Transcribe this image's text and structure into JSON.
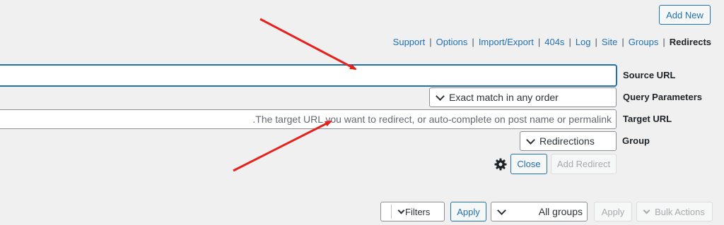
{
  "header": {
    "add_new_label": "Add New"
  },
  "subnav": {
    "items": [
      {
        "label": "Support"
      },
      {
        "label": "Options"
      },
      {
        "label": "Import/Export"
      },
      {
        "label": "404s"
      },
      {
        "label": "Log"
      },
      {
        "label": "Site"
      },
      {
        "label": "Groups"
      }
    ],
    "current": "Redirects",
    "separator": "|"
  },
  "form": {
    "source_url": {
      "label": "Source URL",
      "value": ""
    },
    "query_parameters": {
      "label": "Query Parameters",
      "selected": "Exact match in any order"
    },
    "target_url": {
      "label": "Target URL",
      "placeholder": ".The target URL you want to redirect, or auto-complete on post name or permalink"
    },
    "group": {
      "label": "Group",
      "selected": "Redirections"
    },
    "close_label": "Close",
    "add_redirect_label": "Add Redirect"
  },
  "filter_bar": {
    "filters_label": "Filters",
    "apply_label": "Apply",
    "group_select": "All groups",
    "apply2_label": "Apply",
    "bulk_actions_label": "Bulk Actions"
  },
  "colors": {
    "background": "#f0f0f1",
    "link": "#2271b1",
    "annotation_arrow": "#e8201a"
  },
  "icons": [
    "gear-icon",
    "chevron-down-icon"
  ]
}
